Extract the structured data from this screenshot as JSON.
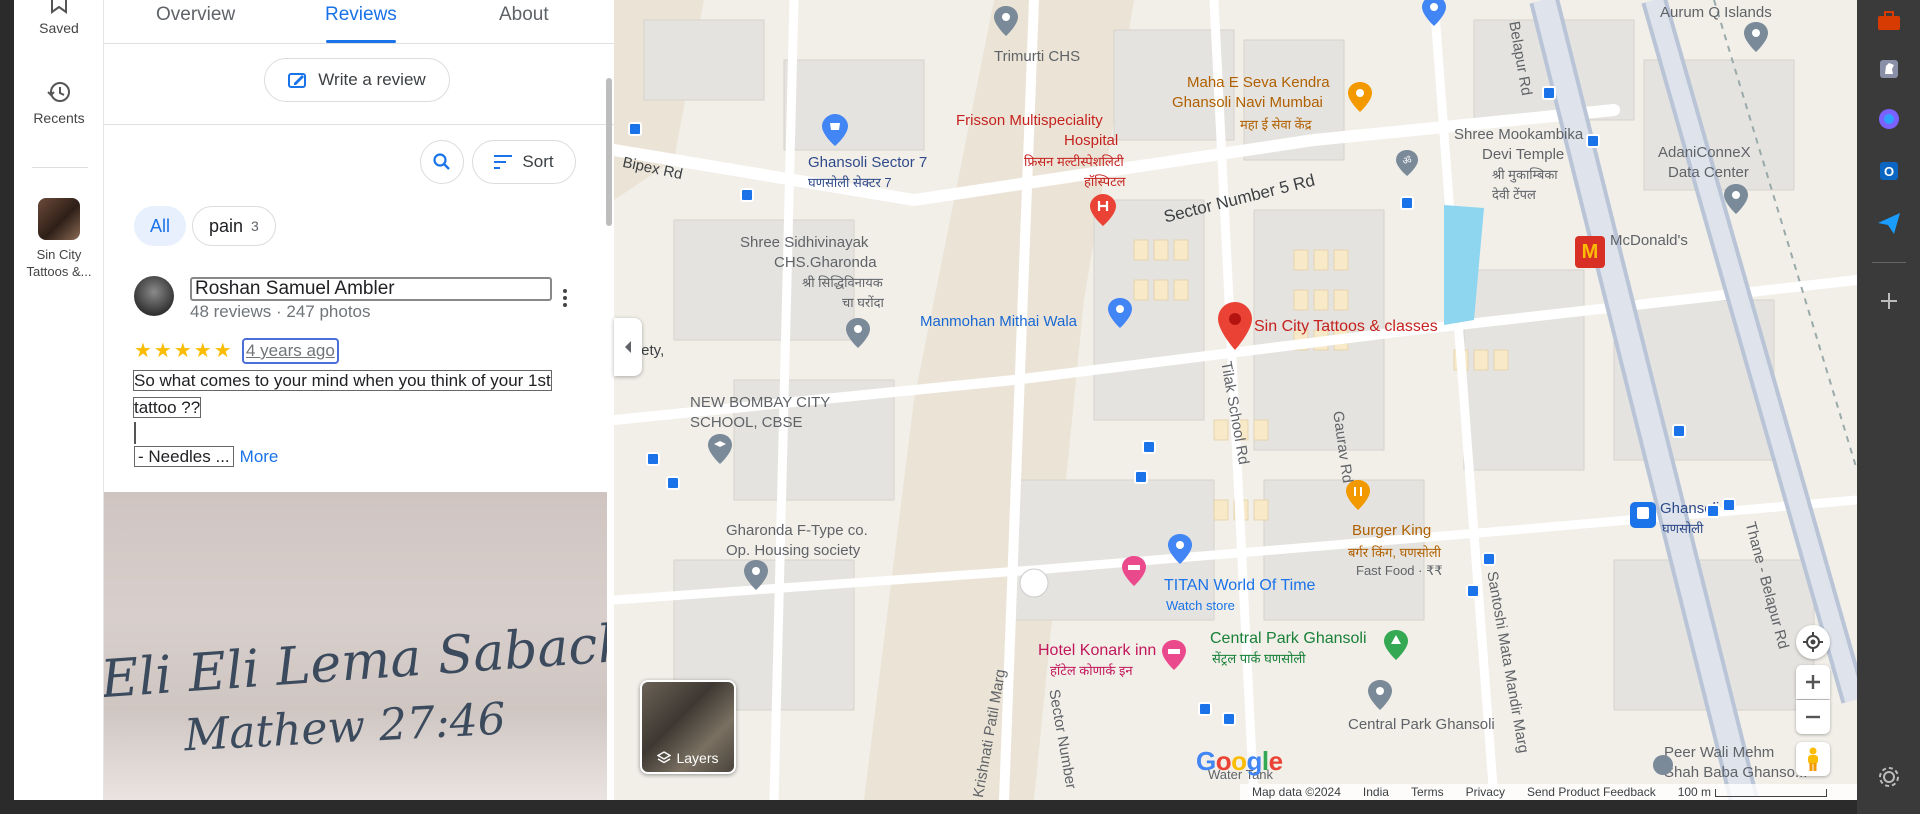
{
  "rail": {
    "saved": "Saved",
    "recents": "Recents",
    "place": "Sin City Tattoos &..."
  },
  "tabs": [
    "Overview",
    "Reviews",
    "About"
  ],
  "write_review": "Write a review",
  "sort_label": "Sort",
  "chips": {
    "all": "All",
    "pain": "pain",
    "pain_count": "3"
  },
  "review": {
    "author": "Roshan Samuel Ambler",
    "author_sub": "48 reviews · 247 photos",
    "stars": "★★★★★",
    "age": "4 years ago",
    "text_line1": "So what comes to your mind when you think of your 1st",
    "text_line2": "tattoo ??",
    "needles": "- Needles ...",
    "more": "More"
  },
  "photo_text": {
    "line1": "Eli Eli Lema Sabachthani",
    "line2": "Mathew 27:46"
  },
  "map": {
    "labels": {
      "trimurti": "Trimurti CHS",
      "maha_e_seva": "Maha E Seva Kendra",
      "maha_e_seva2": "Ghansoli Navi Mumbai",
      "maha_hi": "महा ई सेवा केंद्र",
      "aurum": "Aurum Q Islands",
      "belapur_rd": "Belapur Rd",
      "frisson1": "Frisson Multispeciality",
      "frisson2": "Hospital",
      "frisson_hi1": "फ्रिसन मल्टीस्पेशलिटी",
      "frisson_hi2": "हॉस्पिटल",
      "ghansoli7": "Ghansoli Sector 7",
      "ghansoli7_hi": "घणसोली सेक्टर 7",
      "bipex": "Bipex Rd",
      "sector5": "Sector Number 5 Rd",
      "mookambika1": "Shree Mookambika",
      "mookambika2": "Devi Temple",
      "mookambika_hi1": "श्री मुकाम्बिका",
      "mookambika_hi2": "देवी टेंपल",
      "adani1": "AdaniConneX",
      "adani2": "Data Center",
      "mcd": "McDonald's",
      "siddhi1": "Shree Sidhivinayak",
      "siddhi2": "CHS.Gharonda",
      "siddhi_hi1": "श्री सिद्धिविनायक",
      "siddhi_hi2": "चा घरोंदा",
      "manmohan": "Manmohan Mithai Wala",
      "sincity": "Sin City Tattoos & classes",
      "society": "ociety,",
      "nbcs1": "NEW BOMBAY CITY",
      "nbcs2": "SCHOOL, CBSE",
      "tilak": "Tilak School Rd",
      "gaurav": "Gaurav Rd",
      "ghansoli": "Ghansoli",
      "ghansoli_hi": "घणसोली",
      "gharonda1": "Gharonda F-Type co.",
      "gharonda2": "Op. Housing society",
      "bk": "Burger King",
      "bk_hi": "बर्गर किंग, घणसोली",
      "bk_sub": "Fast Food · ₹₹",
      "titan": "TITAN World Of Time",
      "titan_sub": "Watch store",
      "konark": "Hotel Konark inn",
      "konark_hi": "हॉटेल कोणार्क इन",
      "cpg": "Central Park Ghansoli",
      "cpg_hi": "सेंट्रल पार्क घणसोली",
      "cpg2": "Central Park Ghansoli",
      "thane": "Thane - Belapur Rd",
      "santoshi": "Santoshi Mata Mandir Marg",
      "krishna": "Krishnati Patil Marg",
      "sector_num": "Sector Number",
      "peer1": "Peer Wali Mehm",
      "peer2": "Shah Baba Ghanso...",
      "water": "Water Tank"
    },
    "layers": "Layers",
    "google": "Google",
    "footer": {
      "data": "Map data ©2024",
      "india": "India",
      "terms": "Terms",
      "privacy": "Privacy",
      "feedback": "Send Product Feedback",
      "scale": "100 m"
    }
  },
  "colors": {
    "accent": "#1a73e8",
    "star": "#fbbc04",
    "pin_red": "#ea4335",
    "road": "#ffffff",
    "block": "#e8e5df"
  }
}
